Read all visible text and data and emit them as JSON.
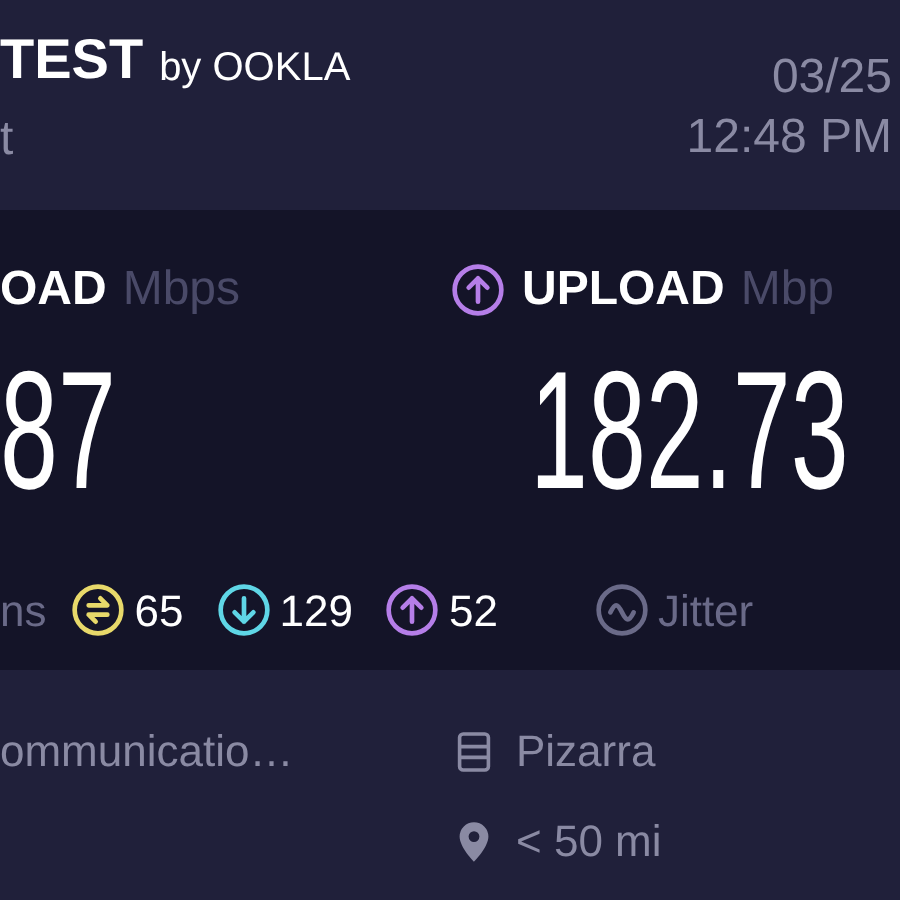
{
  "header": {
    "brand": "TEST",
    "brand_suffix": "by OOKLA",
    "subtitle": "t",
    "date": "03/25",
    "time": "12:48 PM"
  },
  "results": [
    {
      "kind": "download",
      "label": "OAD",
      "unit": "Mbps",
      "value": "87"
    },
    {
      "kind": "upload",
      "label": "UPLOAD",
      "unit": "Mbp",
      "value": "182.73"
    }
  ],
  "ping": {
    "unit": "ns",
    "stats": [
      {
        "kind": "idle",
        "value": "65",
        "color": "#e8d96a"
      },
      {
        "kind": "download",
        "value": "129",
        "color": "#5fd6e6"
      },
      {
        "kind": "upload",
        "value": "52",
        "color": "#b57ee8"
      }
    ],
    "jitter_label": "Jitter"
  },
  "provider": {
    "name": "ommunicatio…"
  },
  "server": {
    "name": "Pizarra",
    "distance": "< 50 mi"
  }
}
